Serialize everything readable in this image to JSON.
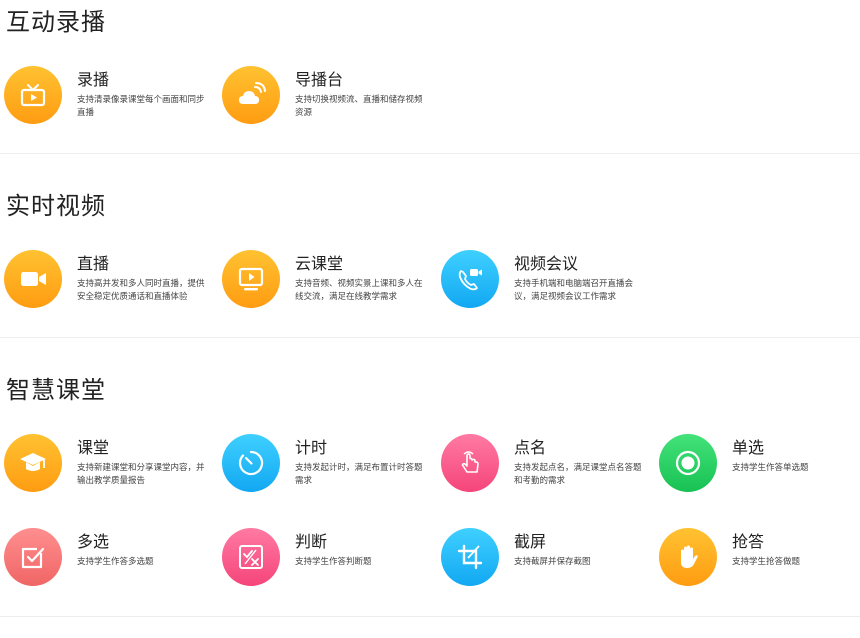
{
  "sections": [
    {
      "title": "互动录播",
      "items": [
        {
          "title": "录播",
          "desc": "支持清录像录课堂每个画面和同步直播",
          "icon": "tv-play-icon",
          "color": "orange"
        },
        {
          "title": "导播台",
          "desc": "支持切换视频流、直播和储存视频资源",
          "icon": "cloud-broadcast-icon",
          "color": "orange"
        }
      ]
    },
    {
      "title": "实时视频",
      "items": [
        {
          "title": "直播",
          "desc": "支持高并发和多人同时直播，提供安全稳定优质通话和直播体验",
          "icon": "video-camera-icon",
          "color": "orange"
        },
        {
          "title": "云课堂",
          "desc": "支持音频、视频实景上课和多人在线交流，满足在线教学需求",
          "icon": "screen-play-icon",
          "color": "orange"
        },
        {
          "title": "视频会议",
          "desc": "支持手机端和电脑端召开直播会议，满足视频会议工作需求",
          "icon": "phone-video-icon",
          "color": "blue"
        }
      ]
    },
    {
      "title": "智慧课堂",
      "items": [
        {
          "title": "课堂",
          "desc": "支持新建课堂和分享课堂内容，并输出教学质量报告",
          "icon": "graduation-cap-icon",
          "color": "orange"
        },
        {
          "title": "计时",
          "desc": "支持发起计时，满足布置计时答题需求",
          "icon": "timer-icon",
          "color": "blue"
        },
        {
          "title": "点名",
          "desc": "支持发起点名，满足课堂点名答题和考勤的需求",
          "icon": "hand-pointer-icon",
          "color": "pink"
        },
        {
          "title": "单选",
          "desc": "支持学生作答单选题",
          "icon": "radio-icon",
          "color": "green"
        },
        {
          "title": "多选",
          "desc": "支持学生作答多选题",
          "icon": "checkbox-icon",
          "color": "salmon"
        },
        {
          "title": "判断",
          "desc": "支持学生作答判断题",
          "icon": "true-false-icon",
          "color": "pink"
        },
        {
          "title": "截屏",
          "desc": "支持截屏并保存截图",
          "icon": "crop-icon",
          "color": "blue"
        },
        {
          "title": "抢答",
          "desc": "支持学生抢答做题",
          "icon": "raised-hand-icon",
          "color": "orange"
        }
      ]
    }
  ]
}
